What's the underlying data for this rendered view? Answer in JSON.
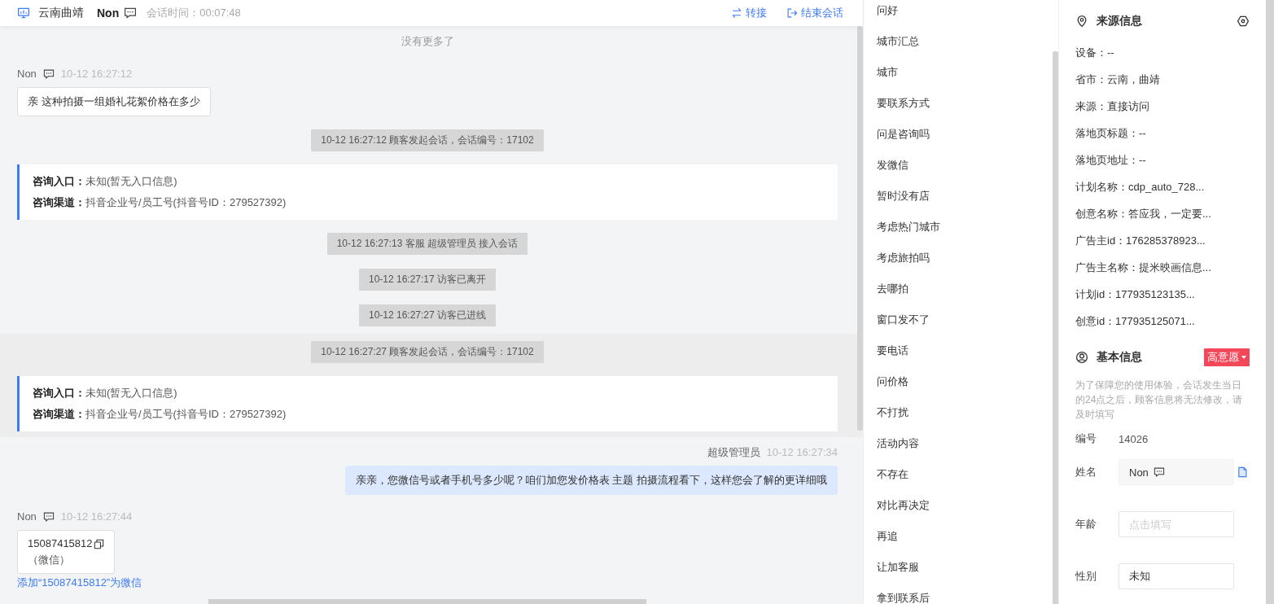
{
  "header": {
    "location": "云南曲靖",
    "visitor": "Non",
    "duration_label": "会话时间：",
    "duration": "00:07:48",
    "actions": [
      {
        "kind": "transfer",
        "label": "转接"
      },
      {
        "kind": "end",
        "label": "结束会话"
      }
    ]
  },
  "chat": {
    "sessions": [
      {
        "highlighted": false,
        "items": [
          {
            "kind": "divider",
            "text": "没有更多了"
          },
          {
            "kind": "visitor",
            "name": "Non",
            "time": "10-12 16:27:12",
            "text": "亲 这种拍摄一组婚礼花絮价格在多少"
          },
          {
            "kind": "system",
            "text": "10-12 16:27:12 顾客发起会话，会话编号：17102"
          },
          {
            "kind": "entry",
            "lines": [
              "**咨询入口：**未知(暂无入口信息)",
              "**咨询渠道：**抖音企业号/员工号(抖音号ID：279527392)"
            ]
          },
          {
            "kind": "system",
            "text": "10-12 16:27:13 客服 超级管理员 接入会话"
          },
          {
            "kind": "system",
            "text": "10-12 16:27:17 访客已离开"
          },
          {
            "kind": "system",
            "text": "10-12 16:27:27 访客已进线"
          }
        ]
      },
      {
        "highlighted": true,
        "items": [
          {
            "kind": "system",
            "text": "10-12 16:27:27 顾客发起会话，会话编号：17102"
          },
          {
            "kind": "entry",
            "lines": [
              "**咨询入口：**未知(暂无入口信息)",
              "**咨询渠道：**抖音企业号/员工号(抖音号ID：279527392)"
            ]
          }
        ]
      },
      {
        "highlighted": false,
        "items": [
          {
            "kind": "agent",
            "name": "超级管理员",
            "time": "10-12 16:27:34",
            "text": "亲亲，您微信号或者手机号多少呢？咱们加您发价格表 主题 拍摄流程看下，这样您会了解的更详细哦"
          },
          {
            "kind": "contact",
            "name": "Non",
            "time": "10-12 16:27:44",
            "number": "15087415812",
            "type": "（微信）",
            "link": "添加“15087415812”为微信"
          }
        ]
      }
    ]
  },
  "quick_replies": [
    "问好",
    "城市汇总",
    "城市",
    "要联系方式",
    "问是咨询吗",
    "发微信",
    "暂时没有店",
    "考虑热门城市",
    "考虑旅拍吗",
    "去哪拍",
    "窗口发不了",
    "要电话",
    "问价格",
    "不打扰",
    "活动内容",
    "不存在",
    "对比再决定",
    "再追",
    "让加客服",
    "拿到联系后"
  ],
  "source_info": {
    "title": "来源信息",
    "rows": [
      "设备：--",
      "省市：云南，曲靖",
      "来源：直接访问",
      "落地页标题：--",
      "落地页地址：--",
      "计划名称：cdp_auto_728...",
      "创意名称：答应我，一定要...",
      "广告主id：176285378923...",
      "广告主名称：提米映画信息...",
      "计划id：177935123135...",
      "创意id：177935125071..."
    ]
  },
  "basic_info": {
    "title": "基本信息",
    "intent_tag": "高意愿",
    "notice": "为了保障您的使用体验，会话发生当日的24点之后，顾客信息将无法修改，请及时填写",
    "fields": [
      {
        "kind": "text",
        "label": "编号",
        "value": "14026"
      },
      {
        "kind": "name",
        "label": "姓名",
        "value": "Non"
      },
      {
        "kind": "input",
        "label": "年龄",
        "placeholder": "点击填写"
      },
      {
        "kind": "input",
        "label": "性别",
        "value": "未知"
      }
    ]
  }
}
